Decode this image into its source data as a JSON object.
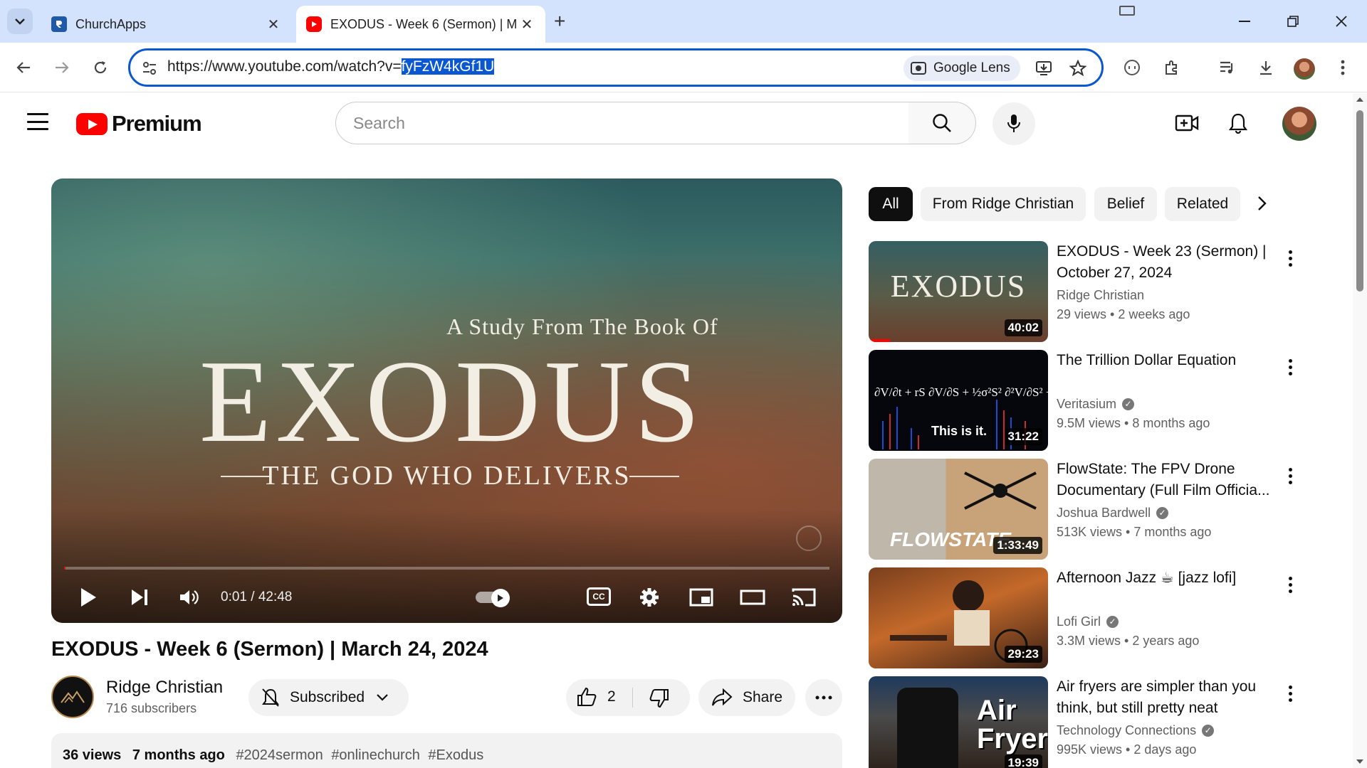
{
  "browser": {
    "tabs": [
      {
        "title": "ChurchApps",
        "active": false
      },
      {
        "title": "EXODUS - Week 6 (Sermon) | M",
        "active": true
      }
    ],
    "url_prefix": "https://www.youtube.com/watch?v=",
    "url_selected": "fyFzW4kGf1U",
    "lens_label": "Google Lens",
    "new_tab_symbol": "+",
    "close_symbol": "✕"
  },
  "youtube": {
    "logo_text": "Premium",
    "search_placeholder": "Search"
  },
  "player": {
    "thumbnail_top_line": "A Study From The Book Of",
    "thumbnail_title": "EXODUS",
    "thumbnail_subtitle": "THE GOD WHO DELIVERS",
    "time_current": "0:01",
    "time_total": "42:48",
    "time_display": "0:01 / 42:48",
    "progress_fraction": 0.0004,
    "cc_label": "CC"
  },
  "video": {
    "title": "EXODUS - Week 6 (Sermon) | March 24, 2024",
    "channel_name": "Ridge Christian",
    "subscribers": "716 subscribers",
    "subscribe_label": "Subscribed",
    "like_count": "2",
    "share_label": "Share",
    "views": "36 views",
    "age": "7 months ago",
    "hashtags": [
      "#2024sermon",
      "#onlinechurch",
      "#Exodus"
    ]
  },
  "filter_chips": [
    "All",
    "From Ridge Christian",
    "Belief",
    "Related"
  ],
  "recommendations": [
    {
      "title": "EXODUS - Week 23 (Sermon) | October 27, 2024",
      "channel": "Ridge Christian",
      "verified": false,
      "views": "29 views",
      "age": "2 weeks ago",
      "meta": "29 views  • 2 weeks ago",
      "duration": "40:02",
      "thumb_text": "EXODUS"
    },
    {
      "title": "The Trillion Dollar Equation",
      "channel": "Veritasium",
      "verified": true,
      "views": "9.5M views",
      "age": "8 months ago",
      "meta": "9.5M views  • 8 months ago",
      "duration": "31:22",
      "thumb_text": "This is it."
    },
    {
      "title": "FlowState: The FPV Drone Documentary (Full Film Officia...",
      "channel": "Joshua Bardwell",
      "verified": true,
      "views": "513K views",
      "age": "7 months ago",
      "meta": "513K views  • 7 months ago",
      "duration": "1:33:49",
      "thumb_text": "FLOWSTATE"
    },
    {
      "title": "Afternoon Jazz ☕ [jazz lofi]",
      "channel": "Lofi Girl",
      "verified": true,
      "views": "3.3M views",
      "age": "2 years ago",
      "meta": "3.3M views  • 2 years ago",
      "duration": "29:23",
      "thumb_text": ""
    },
    {
      "title": "Air fryers are simpler than you think, but still pretty neat",
      "channel": "Technology Connections",
      "verified": true,
      "views": "995K views",
      "age": "2 days ago",
      "meta": "995K views  • 2 days ago",
      "duration": "19:39",
      "thumb_text": "Air Fryers"
    }
  ],
  "colors": {
    "accent": "#ff0000",
    "omnibox_border": "#0b57d0",
    "tabstrip": "#d3e3fd"
  }
}
